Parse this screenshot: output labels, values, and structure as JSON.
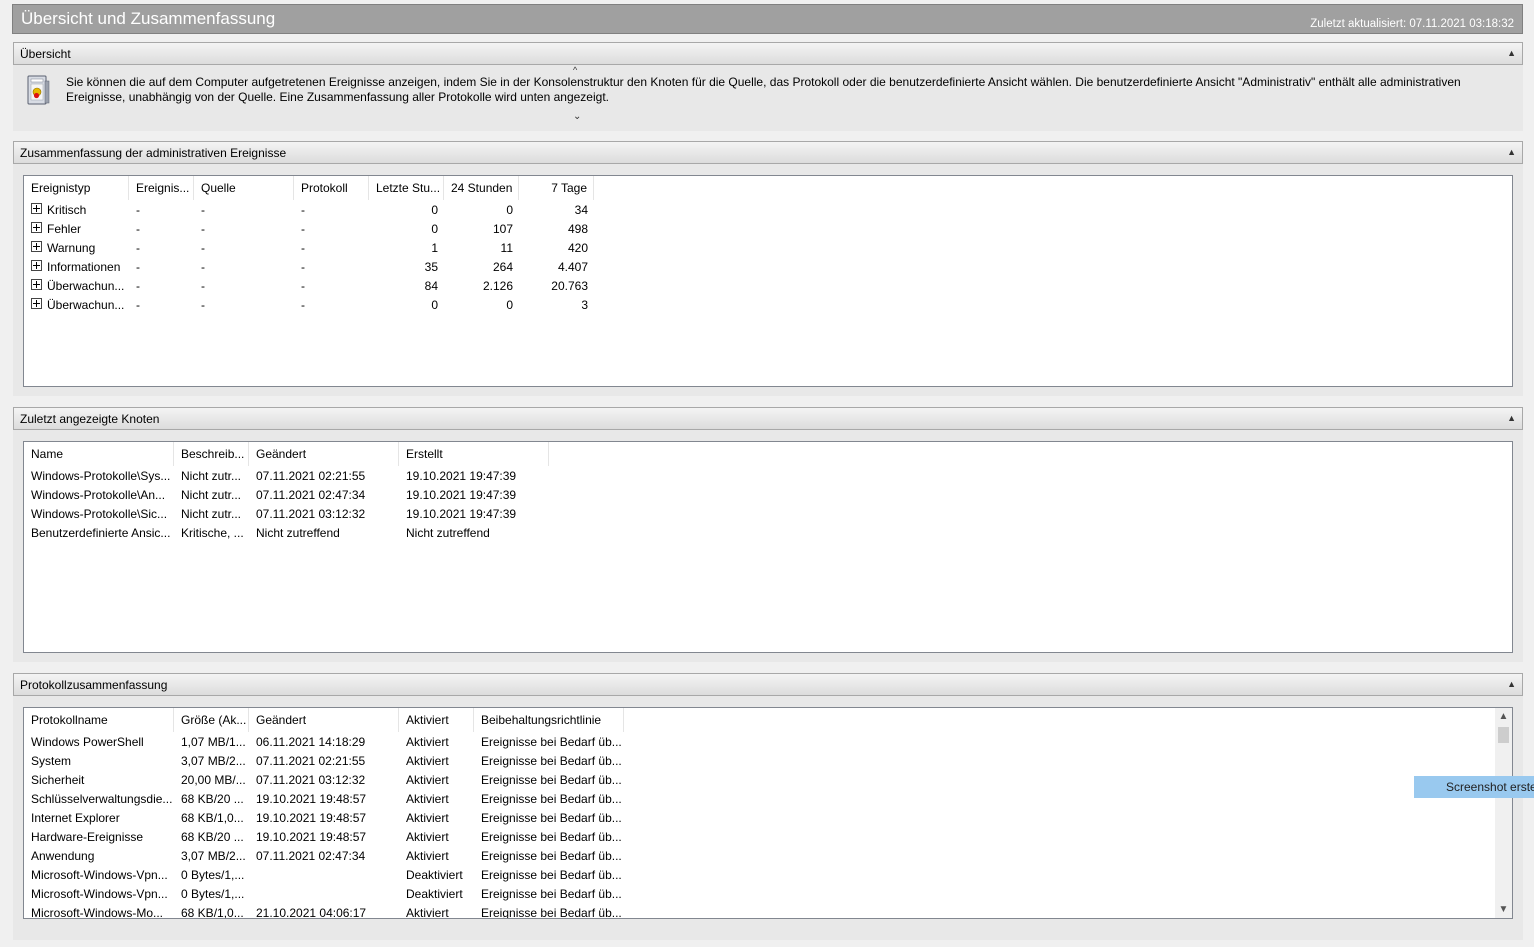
{
  "header": {
    "title": "Übersicht und Zusammenfassung",
    "updated": "Zuletzt aktualisiert: 07.11.2021 03:18:32"
  },
  "overview": {
    "heading": "Übersicht",
    "text": "Sie können die auf dem Computer aufgetretenen Ereignisse anzeigen, indem Sie in der Konsolenstruktur den Knoten für die Quelle, das Protokoll oder die benutzerdefinierte Ansicht wählen. Die benutzerdefinierte Ansicht \"Administrativ\" enthält alle administrativen Ereignisse, unabhängig von der Quelle. Eine Zusammenfassung aller Protokolle wird unten angezeigt."
  },
  "admin_summary": {
    "heading": "Zusammenfassung der administrativen Ereignisse",
    "columns": [
      "Ereignistyp",
      "Ereignis...",
      "Quelle",
      "Protokoll",
      "Letzte Stu...",
      "24 Stunden",
      "7 Tage"
    ],
    "rows": [
      {
        "type": "Kritisch",
        "event": "-",
        "source": "-",
        "log": "-",
        "hour": "0",
        "day": "0",
        "week": "34"
      },
      {
        "type": "Fehler",
        "event": "-",
        "source": "-",
        "log": "-",
        "hour": "0",
        "day": "107",
        "week": "498"
      },
      {
        "type": "Warnung",
        "event": "-",
        "source": "-",
        "log": "-",
        "hour": "1",
        "day": "11",
        "week": "420"
      },
      {
        "type": "Informationen",
        "event": "-",
        "source": "-",
        "log": "-",
        "hour": "35",
        "day": "264",
        "week": "4.407"
      },
      {
        "type": "Überwachun...",
        "event": "-",
        "source": "-",
        "log": "-",
        "hour": "84",
        "day": "2.126",
        "week": "20.763"
      },
      {
        "type": "Überwachun...",
        "event": "-",
        "source": "-",
        "log": "-",
        "hour": "0",
        "day": "0",
        "week": "3"
      }
    ]
  },
  "recent_nodes": {
    "heading": "Zuletzt angezeigte Knoten",
    "columns": [
      "Name",
      "Beschreib...",
      "Geändert",
      "Erstellt"
    ],
    "rows": [
      {
        "name": "Windows-Protokolle\\Sys...",
        "desc": "Nicht zutr...",
        "changed": "07.11.2021 02:21:55",
        "created": "19.10.2021 19:47:39"
      },
      {
        "name": "Windows-Protokolle\\An...",
        "desc": "Nicht zutr...",
        "changed": "07.11.2021 02:47:34",
        "created": "19.10.2021 19:47:39"
      },
      {
        "name": "Windows-Protokolle\\Sic...",
        "desc": "Nicht zutr...",
        "changed": "07.11.2021 03:12:32",
        "created": "19.10.2021 19:47:39"
      },
      {
        "name": "Benutzerdefinierte Ansic...",
        "desc": "Kritische, ...",
        "changed": "Nicht zutreffend",
        "created": "Nicht zutreffend"
      }
    ]
  },
  "log_summary": {
    "heading": "Protokollzusammenfassung",
    "columns": [
      "Protokollname",
      "Größe (Ak...",
      "Geändert",
      "Aktiviert",
      "Beibehaltungsrichtlinie"
    ],
    "rows": [
      {
        "name": "Windows PowerShell",
        "size": "1,07 MB/1...",
        "changed": "06.11.2021 14:18:29",
        "enabled": "Aktiviert",
        "retention": "Ereignisse bei Bedarf üb..."
      },
      {
        "name": "System",
        "size": "3,07 MB/2...",
        "changed": "07.11.2021 02:21:55",
        "enabled": "Aktiviert",
        "retention": "Ereignisse bei Bedarf üb..."
      },
      {
        "name": "Sicherheit",
        "size": "20,00 MB/...",
        "changed": "07.11.2021 03:12:32",
        "enabled": "Aktiviert",
        "retention": "Ereignisse bei Bedarf üb..."
      },
      {
        "name": "Schlüsselverwaltungsdie...",
        "size": "68 KB/20 ...",
        "changed": "19.10.2021 19:48:57",
        "enabled": "Aktiviert",
        "retention": "Ereignisse bei Bedarf üb..."
      },
      {
        "name": "Internet Explorer",
        "size": "68 KB/1,0...",
        "changed": "19.10.2021 19:48:57",
        "enabled": "Aktiviert",
        "retention": "Ereignisse bei Bedarf üb..."
      },
      {
        "name": "Hardware-Ereignisse",
        "size": "68 KB/20 ...",
        "changed": "19.10.2021 19:48:57",
        "enabled": "Aktiviert",
        "retention": "Ereignisse bei Bedarf üb..."
      },
      {
        "name": "Anwendung",
        "size": "3,07 MB/2...",
        "changed": "07.11.2021 02:47:34",
        "enabled": "Aktiviert",
        "retention": "Ereignisse bei Bedarf üb..."
      },
      {
        "name": "Microsoft-Windows-Vpn...",
        "size": "0 Bytes/1,...",
        "changed": "",
        "enabled": "Deaktiviert",
        "retention": "Ereignisse bei Bedarf üb..."
      },
      {
        "name": "Microsoft-Windows-Vpn...",
        "size": "0 Bytes/1,...",
        "changed": "",
        "enabled": "Deaktiviert",
        "retention": "Ereignisse bei Bedarf üb..."
      },
      {
        "name": "Microsoft-Windows-Mo...",
        "size": "68 KB/1,0...",
        "changed": "21.10.2021 04:06:17",
        "enabled": "Aktiviert",
        "retention": "Ereignisse bei Bedarf üb..."
      }
    ]
  },
  "overlay_button": "Screenshot erstel",
  "icons": {
    "overview": "event-viewer-log-icon",
    "collapse": "chevron-up-icon",
    "expand": "plus-box-icon"
  }
}
